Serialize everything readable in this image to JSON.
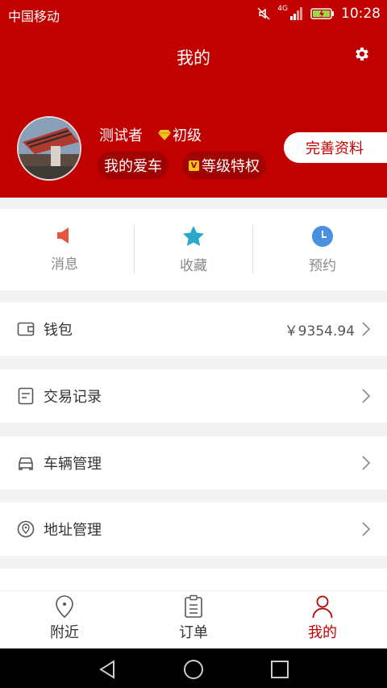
{
  "status_bar": {
    "carrier": "中国移动",
    "network": "4G",
    "time": "10:28"
  },
  "header": {
    "title": "我的",
    "username": "测试者",
    "level": "初级",
    "my_car": "我的爱车",
    "vip_badge": "V",
    "privileges": "等级特权",
    "complete_profile": "完善资料"
  },
  "quick_actions": [
    {
      "label": "消息",
      "icon": "speaker-icon",
      "color": "#e8553e"
    },
    {
      "label": "收藏",
      "icon": "star-icon",
      "color": "#29a9c9"
    },
    {
      "label": "预约",
      "icon": "clock-icon",
      "color": "#4a90e2"
    }
  ],
  "menu": {
    "wallet": {
      "label": "钱包",
      "value": "￥9354.94"
    },
    "transactions": {
      "label": "交易记录"
    },
    "vehicles": {
      "label": "车辆管理"
    },
    "addresses": {
      "label": "地址管理"
    }
  },
  "bottom_nav": [
    {
      "label": "附近",
      "active": false
    },
    {
      "label": "订单",
      "active": false
    },
    {
      "label": "我的",
      "active": true
    }
  ],
  "colors": {
    "brand": "#c10000",
    "chip_bg": "#a10303"
  }
}
